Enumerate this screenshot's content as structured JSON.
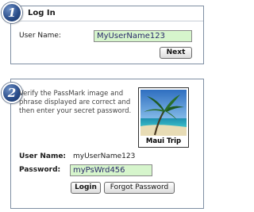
{
  "step1": {
    "number": "1",
    "title": "Log In",
    "username_label": "User Name:",
    "username_value": "MyUserName123",
    "next_label": "Next"
  },
  "step2": {
    "number": "2",
    "instructions": "Verify the PassMark image and phrase displayed are correct and then enter your secret password.",
    "passmark_caption": "Maui Trip",
    "passmark_image": "palm-tree-beach",
    "username_label": "User Name:",
    "username_value": "myUserName123",
    "password_label": "Password:",
    "password_value": "myPsWrd456",
    "login_label": "Login",
    "forgot_label": "Forgot Password"
  },
  "colors": {
    "badge": "#2c4f8c",
    "field_bg": "#d6f5cc",
    "border": "#7f8fa3"
  }
}
